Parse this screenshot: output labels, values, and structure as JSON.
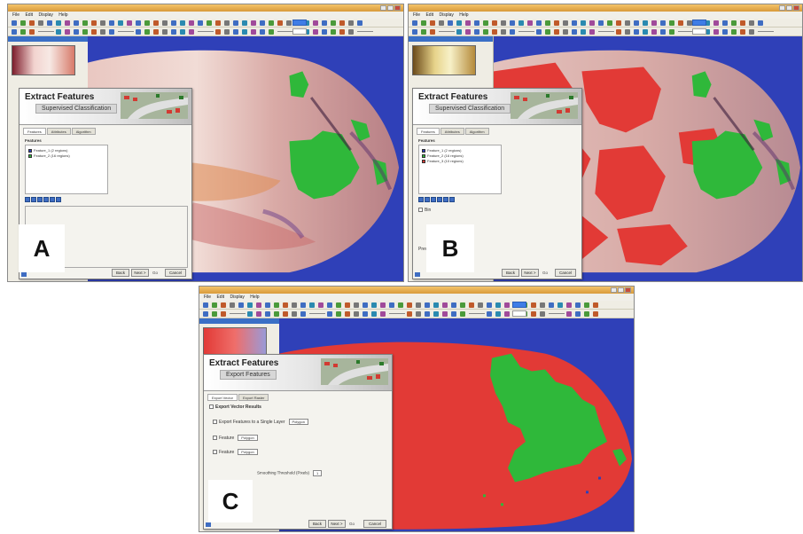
{
  "menu": [
    "File",
    "Edit",
    "Display",
    "Help"
  ],
  "panels": [
    {
      "id": "a",
      "letter": "A",
      "dialog_title": "Extract Features",
      "dialog_subtitle": "Supervised Classification",
      "tabs": [
        "Features",
        "Attributes",
        "Algorithm"
      ],
      "list_header": "Features",
      "features": [
        {
          "label": "Feature_1 (2 regions)",
          "color": "#2f40b8"
        },
        {
          "label": "Feature_2 (16 regions)",
          "color": "#2fb83a"
        }
      ],
      "buttons": [
        "Back",
        "Next >",
        "Cancel"
      ],
      "link": "Go"
    },
    {
      "id": "b",
      "letter": "B",
      "dialog_title": "Extract Features",
      "dialog_subtitle": "Supervised Classification",
      "tabs": [
        "Features",
        "Attributes",
        "Algorithm"
      ],
      "list_header": "Features",
      "features": [
        {
          "label": "Feature_1 (2 regions)",
          "color": "#2f40b8"
        },
        {
          "label": "Feature_2 (16 regions)",
          "color": "#2fb83a"
        },
        {
          "label": "Feature_3 (10 regions)",
          "color": "#e23a36"
        }
      ],
      "options": [
        "Bin",
        "Preview"
      ],
      "buttons": [
        "Back",
        "Next >",
        "Cancel"
      ],
      "link": "Go"
    },
    {
      "id": "c",
      "letter": "C",
      "dialog_title": "Extract Features",
      "dialog_subtitle": "Export Features",
      "tabs": [
        "Export Vector",
        "Export Raster"
      ],
      "export_header": "Export Vector Results",
      "export_options": [
        {
          "label": "Export Features to a Single Layer",
          "select": "Polygon"
        },
        {
          "label": "Feature",
          "select": "Polygon"
        },
        {
          "label": "Feature",
          "select": "Polygon"
        }
      ],
      "smoothing_label": "Smoothing Threshold (Pixels)",
      "smoothing_value": "1",
      "buttons": [
        "Back",
        "Next >",
        "Cancel"
      ],
      "link": "Go"
    }
  ],
  "colors": {
    "background": "#2f40b8",
    "class_green": "#2fb83a",
    "class_red": "#e23a36",
    "fish_base": "#d9b7b4",
    "accent_blue": "#3f7de6",
    "titlebar": "#e5ad52"
  },
  "icons": [
    "window-minimize-icon",
    "window-maximize-icon",
    "window-close-icon",
    "toolbar-icon",
    "zoom-icon",
    "pan-icon",
    "pointer-icon"
  ]
}
